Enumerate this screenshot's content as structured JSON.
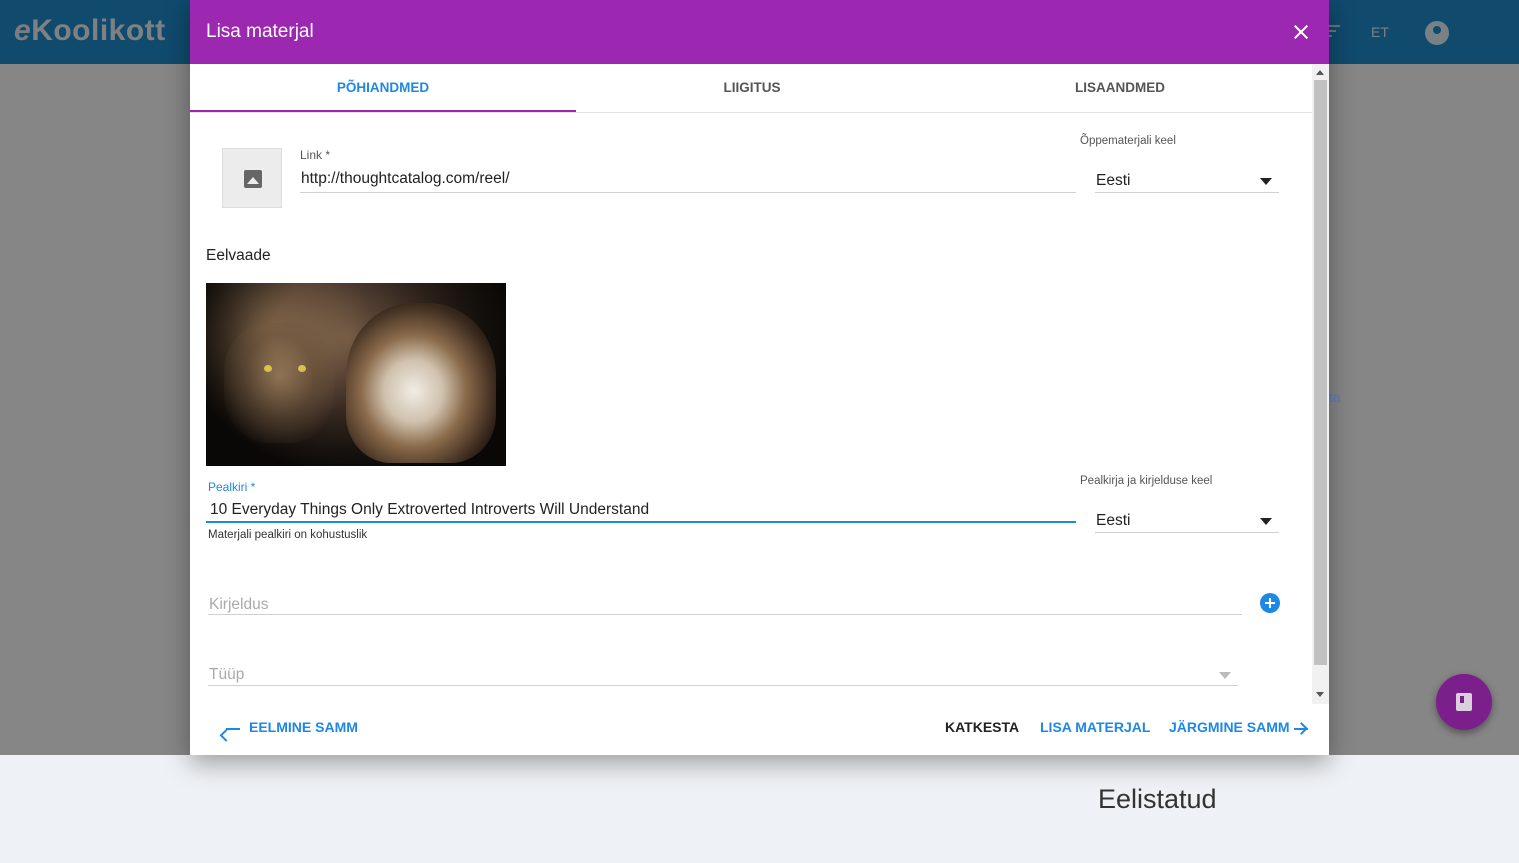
{
  "app": {
    "logo_prefix": "e",
    "logo_text": "Koolikott",
    "language": "ET",
    "background_link_fragment": "ta",
    "favorites_title": "Eelistatud"
  },
  "dialog": {
    "title": "Lisa materjal",
    "tabs": [
      {
        "label": "PÕHIANDMED",
        "active": true
      },
      {
        "label": "LIIGITUS",
        "active": false
      },
      {
        "label": "LISAANDMED",
        "active": false
      }
    ],
    "link": {
      "label": "Link *",
      "value": "http://thoughtcatalog.com/reel/"
    },
    "material_language": {
      "label": "Õppematerjali keel",
      "value": "Eesti"
    },
    "preview_title": "Eelvaade",
    "title_field": {
      "label": "Pealkiri *",
      "value": "10 Everyday Things Only Extroverted Introverts Will Understand",
      "hint": "Materjali pealkiri on kohustuslik"
    },
    "title_language": {
      "label": "Pealkirja ja kirjelduse keel",
      "value": "Eesti"
    },
    "description": {
      "placeholder": "Kirjeldus"
    },
    "type": {
      "placeholder": "Tüüp"
    },
    "buttons": {
      "previous": "EELMINE SAMM",
      "cancel": "KATKESTA",
      "add": "LISA MATERJAL",
      "next": "JÄRGMINE SAMM"
    }
  },
  "colors": {
    "header": "#1f8ac9",
    "dialog_title_bar": "#9c27b0",
    "accent": "#1e88e5",
    "fab": "#7b1f8c"
  },
  "icons": [
    "image-placeholder-icon",
    "close-icon",
    "dropdown-caret-icon",
    "add-circle-icon",
    "arrow-left-icon",
    "arrow-right-icon",
    "filter-icon",
    "account-icon",
    "book-icon"
  ]
}
